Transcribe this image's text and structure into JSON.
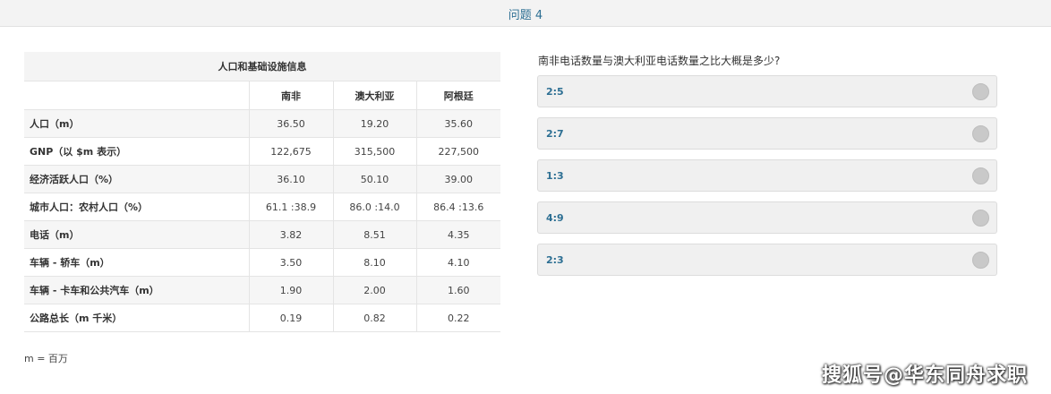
{
  "header": {
    "title": "问题 4"
  },
  "table": {
    "title": "人口和基础设施信息",
    "columns": [
      "南非",
      "澳大利亚",
      "阿根廷"
    ],
    "rows": [
      {
        "label": "人口（m）",
        "values": [
          "36.50",
          "19.20",
          "35.60"
        ]
      },
      {
        "label": "GNP（以 $m 表示）",
        "values": [
          "122,675",
          "315,500",
          "227,500"
        ]
      },
      {
        "label": "经济活跃人口（%）",
        "values": [
          "36.10",
          "50.10",
          "39.00"
        ]
      },
      {
        "label": "城市人口：农村人口（%）",
        "values": [
          "61.1 :38.9",
          "86.0 :14.0",
          "86.4 :13.6"
        ]
      },
      {
        "label": "电话（m）",
        "values": [
          "3.82",
          "8.51",
          "4.35"
        ]
      },
      {
        "label": "车辆 - 轿车（m）",
        "values": [
          "3.50",
          "8.10",
          "4.10"
        ]
      },
      {
        "label": "车辆 - 卡车和公共汽车（m）",
        "values": [
          "1.90",
          "2.00",
          "1.60"
        ]
      },
      {
        "label": "公路总长（m 千米）",
        "values": [
          "0.19",
          "0.82",
          "0.22"
        ]
      }
    ],
    "footnote": "m = 百万"
  },
  "question": {
    "text": "南非电话数量与澳大利亚电话数量之比大概是多少?",
    "options": [
      "2:5",
      "2:7",
      "1:3",
      "4:9",
      "2:3"
    ]
  },
  "watermark": "搜狐号@华东同舟求职"
}
